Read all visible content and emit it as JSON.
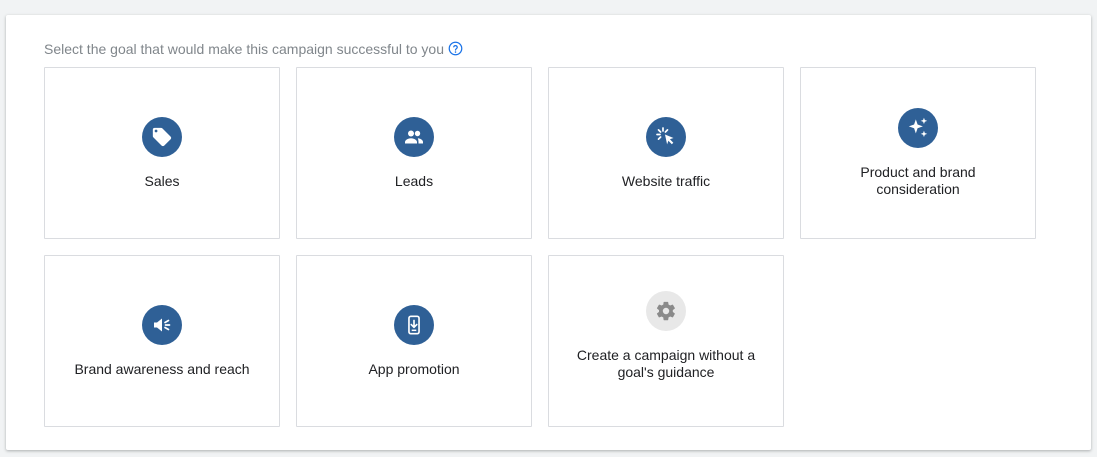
{
  "prompt": {
    "text": "Select the goal that would make this campaign successful to you",
    "help_icon": "help-circle-icon"
  },
  "goals": [
    {
      "label": "Sales",
      "icon": "tag-icon"
    },
    {
      "label": "Leads",
      "icon": "people-icon"
    },
    {
      "label": "Website traffic",
      "icon": "cursor-click-icon"
    },
    {
      "label": "Product and brand consideration",
      "icon": "sparkle-icon"
    },
    {
      "label": "Brand awareness and reach",
      "icon": "megaphone-icon"
    },
    {
      "label": "App promotion",
      "icon": "phone-download-icon"
    },
    {
      "label": "Create a campaign without a goal's guidance",
      "icon": "gear-icon"
    }
  ],
  "colors": {
    "icon_bg": "#2f6096",
    "icon_bg_muted": "#e8e8e8",
    "icon_fg_muted": "#8a8a8a",
    "help_icon": "#1a73e8"
  }
}
